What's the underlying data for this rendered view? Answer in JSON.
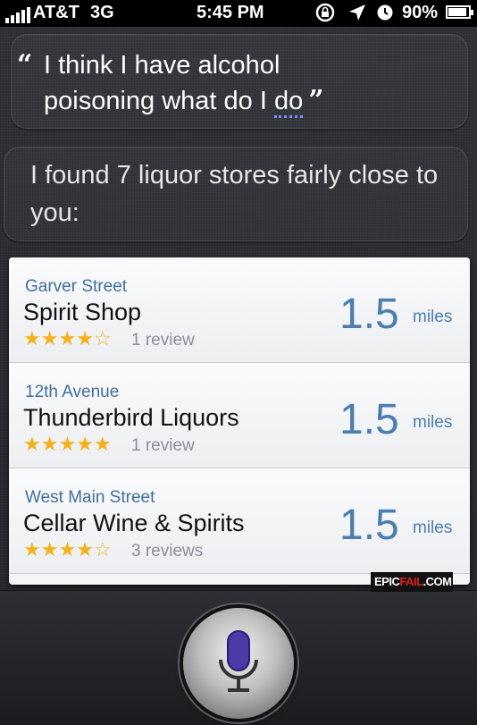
{
  "status_bar": {
    "carrier": "AT&T",
    "network": "3G",
    "time": "5:45 PM",
    "battery_pct": "90%",
    "battery_level": 0.9
  },
  "conversation": {
    "user_query_line1": "I think I have alcohol",
    "user_query_line2_start": "poisoning what do I ",
    "user_query_line2_underlined": "do",
    "siri_response": "I found 7 liquor stores fairly close to you:"
  },
  "results": [
    {
      "street": "Garver Street",
      "name": "Spirit Shop",
      "rating": 4,
      "reviews": "1 review",
      "distance": "1.5",
      "unit": "miles"
    },
    {
      "street": "12th Avenue",
      "name": "Thunderbird Liquors",
      "rating": 5,
      "reviews": "1 review",
      "distance": "1.5",
      "unit": "miles"
    },
    {
      "street": "West Main Street",
      "name": "Cellar Wine & Spirits",
      "rating": 4,
      "reviews": "3 reviews",
      "distance": "1.5",
      "unit": "miles"
    }
  ],
  "watermark": {
    "part1": "EPIC",
    "part2": "FAIL",
    "part3": ".COM"
  },
  "icons": {
    "mic": "microphone-icon",
    "lock": "rotation-lock-icon",
    "location": "location-arrow-icon",
    "alarm": "alarm-clock-icon"
  },
  "colors": {
    "star": "#f3b21a",
    "distance": "#4a7db0",
    "street": "#3f6f9c",
    "mic_accent": "#4b3aa8"
  }
}
